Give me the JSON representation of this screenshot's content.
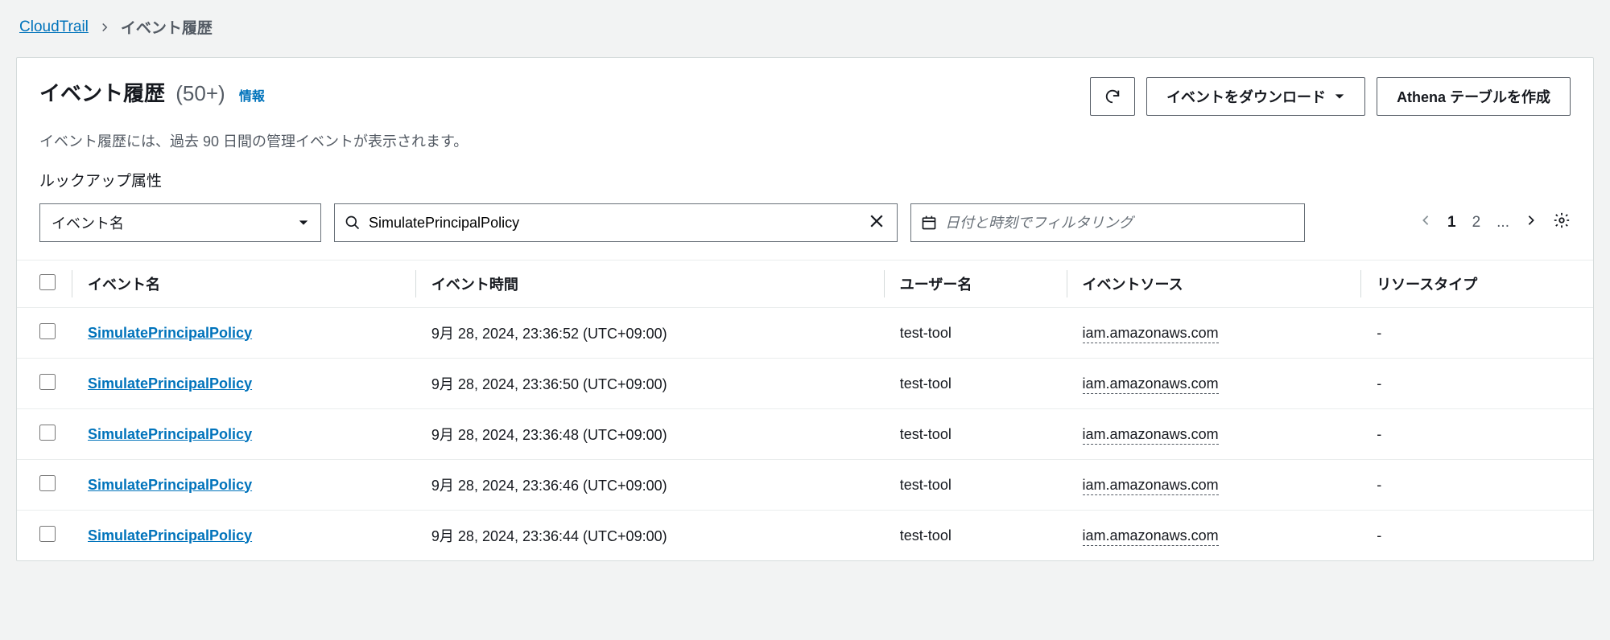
{
  "breadcrumb": {
    "root": "CloudTrail",
    "current": "イベント履歴"
  },
  "header": {
    "title": "イベント履歴",
    "count": "(50+)",
    "info": "情報",
    "subtitle": "イベント履歴には、過去 90 日間の管理イベントが表示されます。"
  },
  "actions": {
    "download": "イベントをダウンロード",
    "create_athena": "Athena テーブルを作成"
  },
  "filters": {
    "label": "ルックアップ属性",
    "attribute_select": "イベント名",
    "search_value": "SimulatePrincipalPolicy",
    "date_placeholder": "日付と時刻でフィルタリング"
  },
  "paginator": {
    "page1": "1",
    "page2": "2",
    "ellipsis": "..."
  },
  "table": {
    "headers": {
      "event_name": "イベント名",
      "event_time": "イベント時間",
      "user_name": "ユーザー名",
      "event_source": "イベントソース",
      "resource_type": "リソースタイプ"
    },
    "rows": [
      {
        "event_name": "SimulatePrincipalPolicy",
        "event_time": "9月 28, 2024, 23:36:52 (UTC+09:00)",
        "user_name": "test-tool",
        "event_source": "iam.amazonaws.com",
        "resource_type": "-"
      },
      {
        "event_name": "SimulatePrincipalPolicy",
        "event_time": "9月 28, 2024, 23:36:50 (UTC+09:00)",
        "user_name": "test-tool",
        "event_source": "iam.amazonaws.com",
        "resource_type": "-"
      },
      {
        "event_name": "SimulatePrincipalPolicy",
        "event_time": "9月 28, 2024, 23:36:48 (UTC+09:00)",
        "user_name": "test-tool",
        "event_source": "iam.amazonaws.com",
        "resource_type": "-"
      },
      {
        "event_name": "SimulatePrincipalPolicy",
        "event_time": "9月 28, 2024, 23:36:46 (UTC+09:00)",
        "user_name": "test-tool",
        "event_source": "iam.amazonaws.com",
        "resource_type": "-"
      },
      {
        "event_name": "SimulatePrincipalPolicy",
        "event_time": "9月 28, 2024, 23:36:44 (UTC+09:00)",
        "user_name": "test-tool",
        "event_source": "iam.amazonaws.com",
        "resource_type": "-"
      }
    ]
  }
}
